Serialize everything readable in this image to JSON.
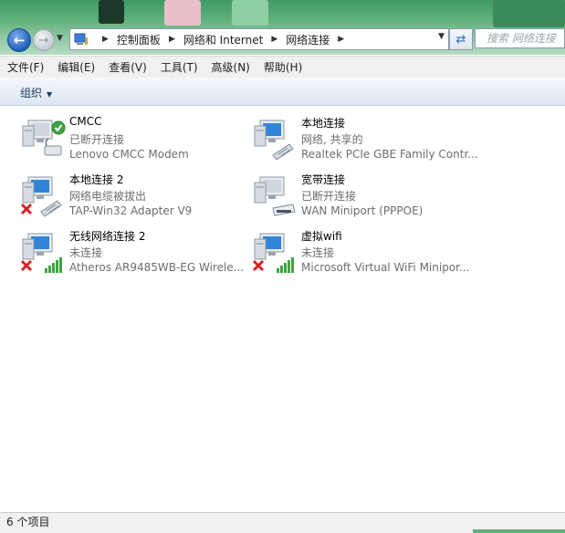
{
  "nav": {
    "breadcrumbs": [
      "控制面板",
      "网络和 Internet",
      "网络连接"
    ],
    "search_placeholder": "搜索 网络连接"
  },
  "menu": [
    "文件(F)",
    "编辑(E)",
    "查看(V)",
    "工具(T)",
    "高级(N)",
    "帮助(H)"
  ],
  "toolbar": {
    "organize_label": "组织"
  },
  "connections": [
    {
      "name": "CMCC",
      "status": "已断开连接",
      "device": "Lenovo CMCC Modem",
      "icon": "modem",
      "badge": "check"
    },
    {
      "name": "本地连接",
      "status": "网络, 共享的",
      "device": "Realtek PCIe GBE Family Contr...",
      "icon": "ethernet",
      "badge": "none"
    },
    {
      "name": "本地连接 2",
      "status": "网络电缆被拔出",
      "device": "TAP-Win32 Adapter V9",
      "icon": "ethernet",
      "badge": "x"
    },
    {
      "name": "宽带连接",
      "status": "已断开连接",
      "device": "WAN Miniport (PPPOE)",
      "icon": "broadband",
      "badge": "none"
    },
    {
      "name": "无线网络连接 2",
      "status": "未连接",
      "device": "Atheros AR9485WB-EG Wirele...",
      "icon": "wireless",
      "badge": "x"
    },
    {
      "name": "虚拟wifi",
      "status": "未连接",
      "device": "Microsoft Virtual WiFi Minipor...",
      "icon": "wireless",
      "badge": "x"
    }
  ],
  "statusbar": {
    "count_text": "6 个项目"
  }
}
